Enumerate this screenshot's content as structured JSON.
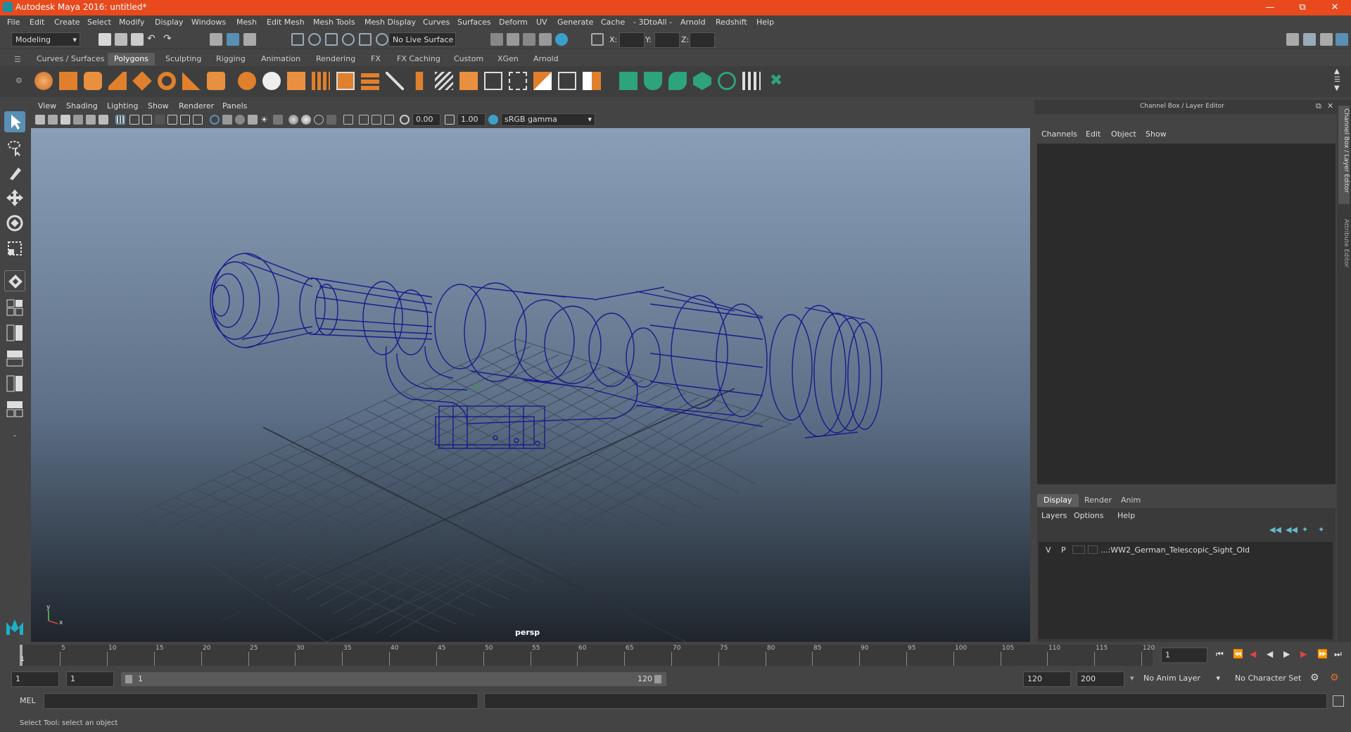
{
  "app": {
    "title": "Autodesk Maya 2016: untitled*"
  },
  "menu": [
    "File",
    "Edit",
    "Create",
    "Select",
    "Modify",
    "Display",
    "Windows",
    "Mesh",
    "Edit Mesh",
    "Mesh Tools",
    "Mesh Display",
    "Curves",
    "Surfaces",
    "Deform",
    "UV",
    "Generate",
    "Cache",
    "- 3DtoAll -",
    "Arnold",
    "Redshift",
    "Help"
  ],
  "status": {
    "mode": "Modeling",
    "live_surface": "No Live Surface",
    "x_label": "X:",
    "y_label": "Y:",
    "z_label": "Z:"
  },
  "shelf_tabs": [
    "Curves / Surfaces",
    "Polygons",
    "Sculpting",
    "Rigging",
    "Animation",
    "Rendering",
    "FX",
    "FX Caching",
    "Custom",
    "XGen",
    "Arnold"
  ],
  "shelf_active": "Polygons",
  "viewport": {
    "menu": [
      "View",
      "Shading",
      "Lighting",
      "Show",
      "Renderer",
      "Panels"
    ],
    "exposure": "0.00",
    "gamma": "1.00",
    "colorspace": "sRGB gamma",
    "camera": "persp",
    "axis_x": "x",
    "axis_y": "y"
  },
  "channel_box": {
    "title": "Channel Box / Layer Editor",
    "menu": [
      "Channels",
      "Edit",
      "Object",
      "Show"
    ]
  },
  "layer_editor": {
    "tabs": [
      "Display",
      "Render",
      "Anim"
    ],
    "active_tab": "Display",
    "menu": [
      "Layers",
      "Options",
      "Help"
    ],
    "layers": [
      {
        "v": "V",
        "p": "P",
        "name": "...:WW2_German_Telescopic_Sight_Old"
      }
    ]
  },
  "side_tabs": [
    "Channel Box / Layer Editor",
    "Attribute Editor"
  ],
  "timeline": {
    "ticks": [
      "5",
      "10",
      "15",
      "20",
      "25",
      "30",
      "35",
      "40",
      "45",
      "50",
      "55",
      "60",
      "65",
      "70",
      "75",
      "80",
      "85",
      "90",
      "95",
      "100",
      "105",
      "110",
      "115",
      "120"
    ],
    "current_frame_marker": "1",
    "current_frame": "1"
  },
  "range": {
    "start": "1",
    "anim_start": "1",
    "slider_start": "1",
    "slider_end": "120",
    "end": "120",
    "anim_end": "200",
    "anim_layer": "No Anim Layer",
    "character_set": "No Character Set"
  },
  "command": {
    "label": "MEL"
  },
  "help": {
    "text": "Select Tool: select an object"
  }
}
